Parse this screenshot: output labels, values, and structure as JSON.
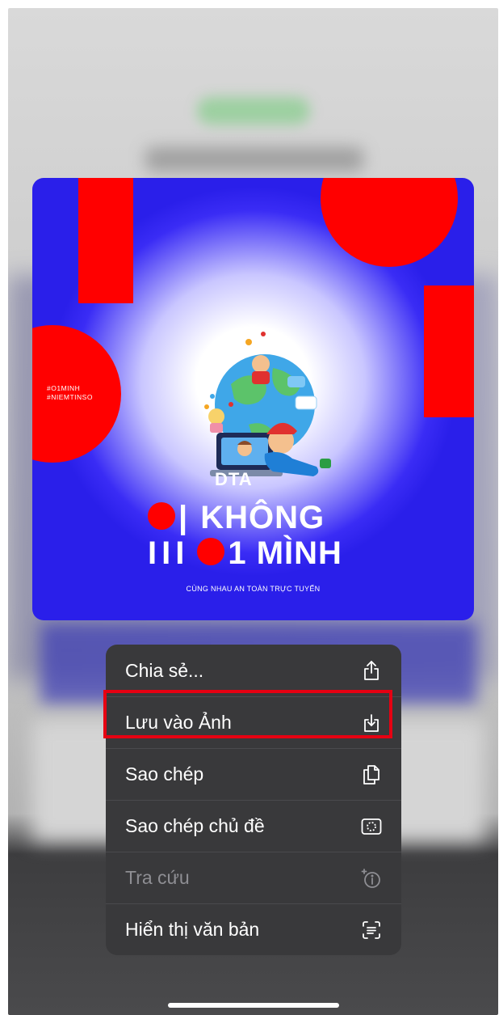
{
  "preview": {
    "hashtags": "#O1MINH\n#NIEMTINSO",
    "brand": "DTA",
    "line1": "KHÔNG",
    "line2": "1 MÌNH",
    "tagline": "CÙNG NHAU AN TOÀN TRỰC TUYẾN"
  },
  "menu": {
    "items": [
      {
        "label": "Chia sẻ...",
        "icon": "share-icon",
        "enabled": true
      },
      {
        "label": "Lưu vào Ảnh",
        "icon": "save-to-photos-icon",
        "enabled": true,
        "highlighted": true
      },
      {
        "label": "Sao chép",
        "icon": "copy-icon",
        "enabled": true
      },
      {
        "label": "Sao chép chủ đề",
        "icon": "copy-subject-icon",
        "enabled": true
      },
      {
        "label": "Tra cứu",
        "icon": "look-up-icon",
        "enabled": false
      },
      {
        "label": "Hiển thị văn bản",
        "icon": "show-text-icon",
        "enabled": true
      }
    ]
  },
  "colors": {
    "menu_background": "#39393b",
    "highlight_border": "#e60012",
    "poster_blue": "#2a1fea",
    "poster_red": "#ff0000"
  }
}
